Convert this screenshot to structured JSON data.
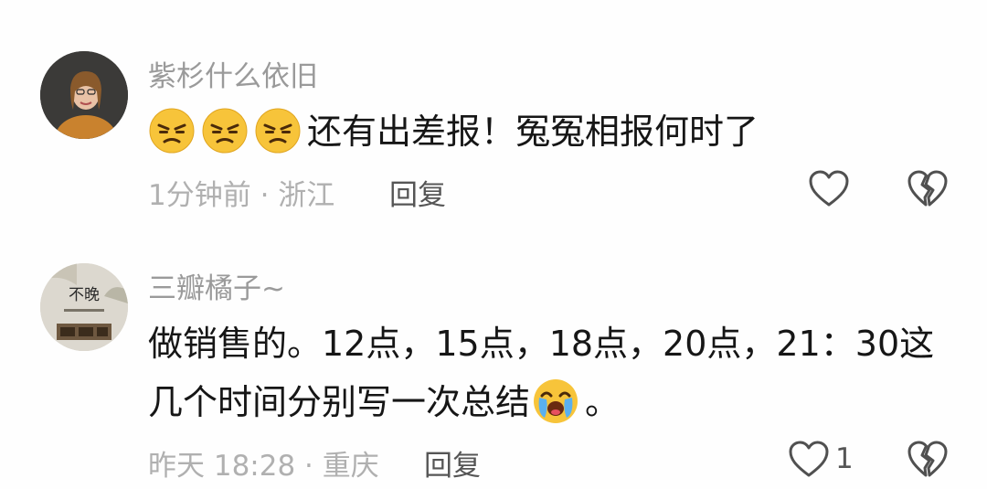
{
  "comments": [
    {
      "username": "紫杉什么依旧",
      "text": "还有出差报！冤冤相报何时了",
      "emojis": [
        "grimace-face-icon",
        "grimace-face-icon",
        "grimace-face-icon"
      ],
      "meta": "1分钟前 · 浙江",
      "reply_label": "回复",
      "like_count": ""
    },
    {
      "username": "三瓣橘子~",
      "text_line1": "做销售的。12点，15点，18点，20点，21：30这",
      "text_line2": "几个时间分别写一次总结",
      "text_after_emoji": "。",
      "emoji": "crying-face-icon",
      "avatar_text": "不晚",
      "meta": "昨天 18:28 · 重庆",
      "reply_label": "回复",
      "like_count": "1"
    }
  ],
  "colors": {
    "username": "#9a9a9a",
    "body": "#161616",
    "meta": "#b0b0b0",
    "reply": "#555555"
  }
}
